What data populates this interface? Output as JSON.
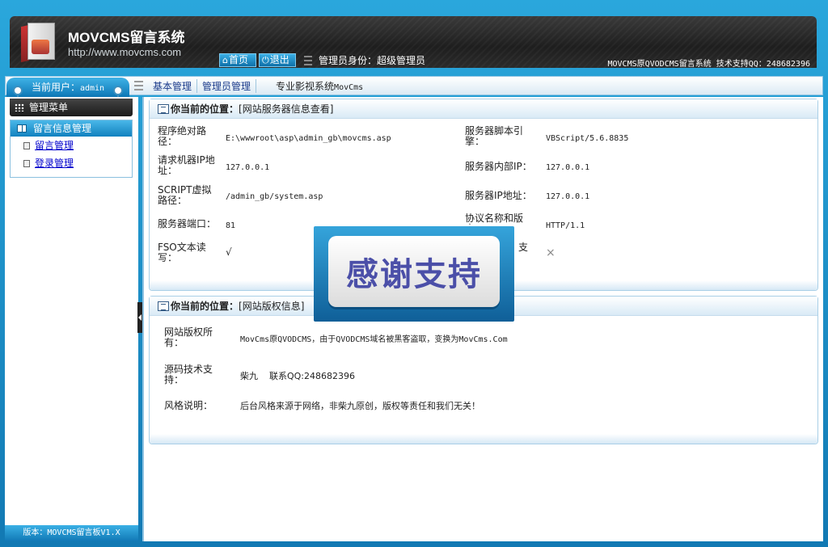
{
  "header": {
    "title": "MOVCMS留言系统",
    "url": "http://www.movcms.com",
    "home_label": "首页",
    "logout_label": "退出",
    "role_text": "管理员身份：超级管理员",
    "support_text": "MOVCMS原QVODCMS留言系统 技术支持QQ：248682396"
  },
  "user": {
    "label": "当前用户：",
    "name": "admin"
  },
  "topnav": {
    "items": [
      "基本管理",
      "管理员管理"
    ],
    "plain_prefix": "专业影视系统",
    "plain_suffix": "MovCms"
  },
  "sidebar": {
    "menu_title": "管理菜单",
    "group_title": "留言信息管理",
    "items": [
      "留言管理",
      "登录管理"
    ],
    "version": "版本：MOVCMS留言板V1.X"
  },
  "panel1": {
    "location_label": "你当前的位置：",
    "location_value": "[网站服务器信息查看]",
    "rows": [
      {
        "label": "程序绝对路径：",
        "value": "E:\\wwwroot\\asp\\admin_gb\\movcms.asp",
        "label2": "服务器脚本引擎：",
        "value2": "VBScript/5.6.8835"
      },
      {
        "label": "请求机器IP地址：",
        "value": "127.0.0.1",
        "label2": "服务器内部IP：",
        "value2": "127.0.0.1"
      },
      {
        "label": "SCRIPT虚拟路径：",
        "value": "/admin_gb/system.asp",
        "label2": "服务器IP地址：",
        "value2": "127.0.0.1"
      },
      {
        "label": "服务器端口：",
        "value": "81",
        "label2": "协议名称和版本：",
        "value2": "HTTP/1.1"
      },
      {
        "label": "FSO文本读写：",
        "value": "√",
        "label2": "支",
        "value2": "×"
      }
    ]
  },
  "panel2": {
    "location_label": "你当前的位置：",
    "location_value": "[网站版权信息]",
    "rows": [
      {
        "label": "网站版权所有：",
        "value": "MovCms原QVODCMS，由于QVODCMS域名被黑客盗取，变换为MovCms.Com"
      },
      {
        "label": "源码技术支持：",
        "value": "柴九    联系QQ:248682396"
      },
      {
        "label": "风格说明：",
        "value": "后台风格来源于网络，非柴九原创，版权等责任和我们无关！"
      }
    ]
  },
  "badge": {
    "text": "感谢支持"
  },
  "colors": {
    "frame": "#1b8fc5",
    "header_dark": "#1e1e1e",
    "link": "#0000cc",
    "badge_text": "#4b4fa8"
  }
}
